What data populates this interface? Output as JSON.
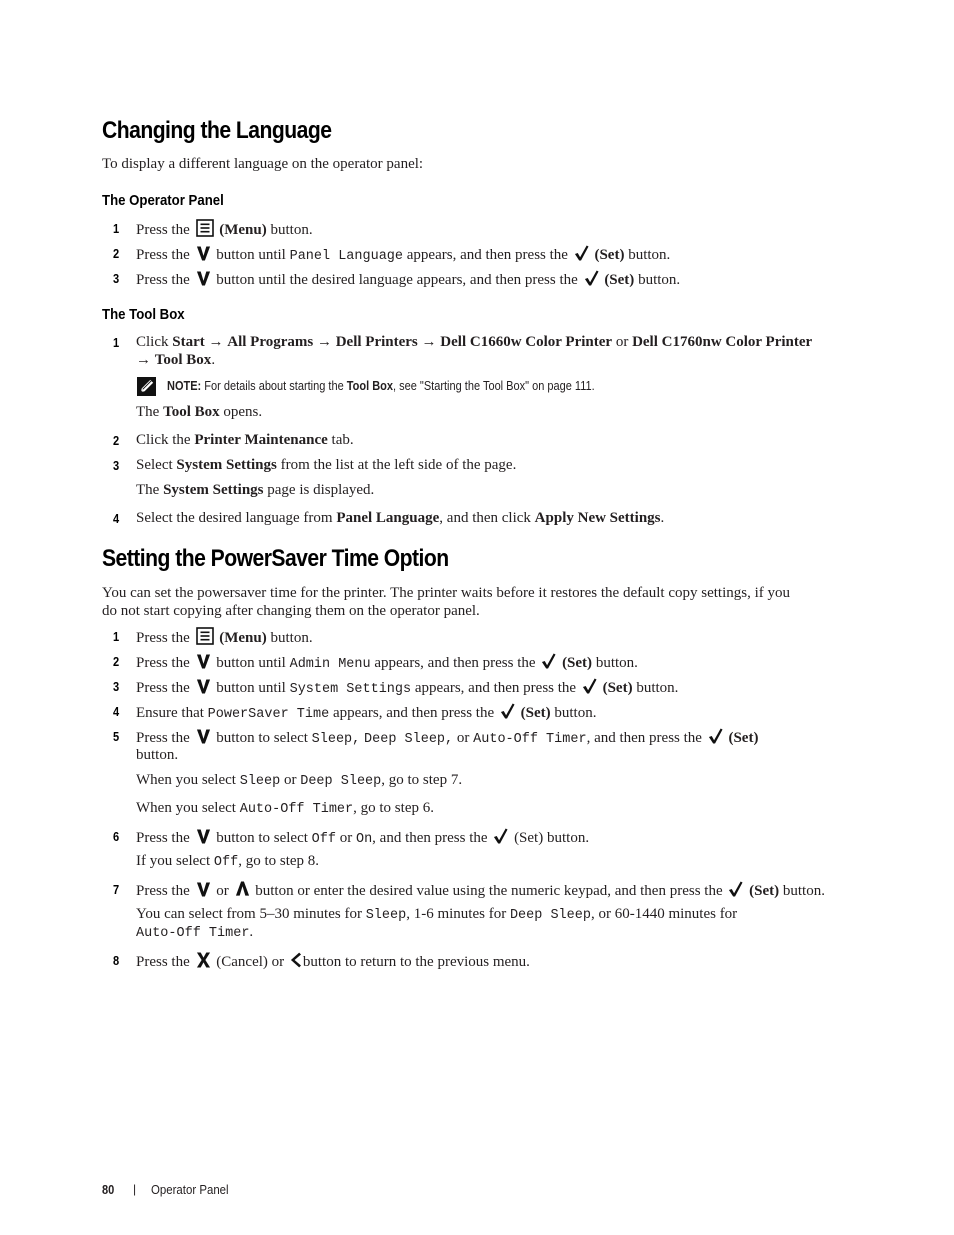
{
  "section1": {
    "title": "Changing the Language",
    "intro": "To display a different language on the operator panel:",
    "operator_panel": {
      "heading": "The Operator Panel",
      "steps": [
        {
          "num": "1",
          "pre": "Press the",
          "icon": "menu-icon",
          "bold": "(Menu)",
          "post": "button."
        },
        {
          "num": "2",
          "pre": "Press the",
          "icon": "down-arrow-icon",
          "mid": "button until",
          "code": "Panel Language",
          "mid2": "appears, and then press the",
          "icon2": "check-icon",
          "bold": "(Set)",
          "post": "button."
        },
        {
          "num": "3",
          "pre": "Press the",
          "icon": "down-arrow-icon",
          "mid": "button until the desired language appears, and then press the",
          "icon2": "check-icon",
          "bold": "(Set)",
          "post": "button."
        }
      ]
    },
    "tool_box": {
      "heading": "The Tool Box",
      "step1": {
        "num": "1",
        "t1": "Click",
        "b1": "Start",
        "arrow": "→",
        "b2": "All Programs",
        "b3": "Dell Printers",
        "b4": "Dell C1660w Color Printer",
        "or": "or",
        "b5": "Dell C1760nw Color Printer",
        "b6": "Tool Box",
        "end": "."
      },
      "note": {
        "label": "NOTE:",
        "t1": "For details about starting the",
        "b1": "Tool Box",
        "t2": ", see \"Starting the Tool Box\" on page 111."
      },
      "result1": {
        "t1": "The",
        "b1": "Tool Box",
        "t2": "opens."
      },
      "step2": {
        "num": "2",
        "t1": "Click the",
        "b1": "Printer Maintenance",
        "t2": "tab."
      },
      "step3": {
        "num": "3",
        "t1": "Select",
        "b1": "System Settings",
        "t2": "from the list at the left side of the page."
      },
      "result3": {
        "t1": "The",
        "b1": "System Settings",
        "t2": "page is displayed."
      },
      "step4": {
        "num": "4",
        "t1": "Select the desired language from",
        "b1": "Panel Language",
        "t2": ", and then click",
        "b2": "Apply New Settings",
        "end": "."
      }
    }
  },
  "section2": {
    "title": "Setting the PowerSaver Time Option",
    "intro_line1": "You can set the powersaver time for the printer. The printer waits before it restores the default copy settings, if you",
    "intro_line2": "do not start copying after changing them on the operator panel.",
    "s1": {
      "num": "1",
      "pre": "Press the",
      "bold": "(Menu)",
      "post": "button."
    },
    "s2": {
      "num": "2",
      "pre": "Press the",
      "mid": "button until",
      "code": "Admin Menu",
      "mid2": "appears, and then press the",
      "bold": "(Set)",
      "post": "button."
    },
    "s3": {
      "num": "3",
      "pre": "Press the",
      "mid": "button until",
      "code": "System Settings",
      "mid2": "appears, and then press the",
      "bold": "(Set)",
      "post": "button."
    },
    "s4": {
      "num": "4",
      "pre": "Ensure that",
      "code": "PowerSaver Time",
      "mid2": "appears, and then press the",
      "bold": "(Set)",
      "post": "button."
    },
    "s5": {
      "num": "5",
      "pre": "Press the",
      "mid": "button to select",
      "c1": "Sleep,",
      "c2": "Deep Sleep,",
      "or": "or",
      "c3": "Auto-Off Timer",
      "mid2": ", and then press the",
      "bold": "(Set)",
      "post": "button."
    },
    "s5_note1": {
      "t1": "When you select",
      "c1": "Sleep",
      "or": "or",
      "c2": "Deep Sleep",
      "t2": ", go to step 7."
    },
    "s5_note2": {
      "t1": "When you select",
      "c1": "Auto-Off Timer",
      "t2": ", go to step 6."
    },
    "s6": {
      "num": "6",
      "pre": "Press the",
      "mid": "button to select",
      "c1": "Off",
      "or": "or",
      "c2": "On",
      "mid2": ", and then press the",
      "plain": "(Set)",
      "post": "button."
    },
    "s6_note": {
      "t1": "If you select",
      "c1": "Off",
      "t2": ", go to step 8."
    },
    "s7": {
      "num": "7",
      "pre": "Press the",
      "or": "or",
      "mid": "button or enter the desired value using the numeric keypad, and then press the",
      "bold": "(Set)",
      "post": "button."
    },
    "s7_note": {
      "t1": "You can select from 5–30 minutes for",
      "c1": "Sleep",
      "t2": ", 1-6 minutes for",
      "c2": "Deep Sleep",
      "t3": ", or 60-1440 minutes for",
      "c3": "Auto-Off Timer",
      "end": "."
    },
    "s8": {
      "num": "8",
      "pre": "Press the",
      "plain": "(Cancel) or",
      "post": "button to return to the previous menu."
    }
  },
  "footer": {
    "page": "80",
    "sep": "|",
    "section": "Operator Panel"
  }
}
